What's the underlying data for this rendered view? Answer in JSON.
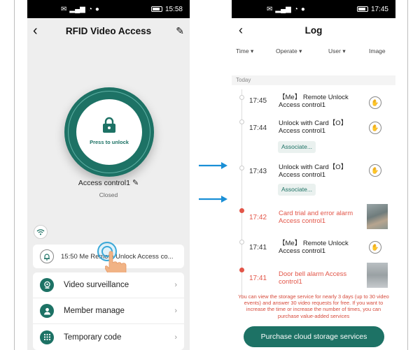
{
  "left_phone": {
    "status": {
      "left": "✉ ᵛᵒₗₗₗ ◔ ■",
      "time": "15:58"
    },
    "header": {
      "title": "RFID Video Access"
    },
    "dial": {
      "label": "Press to unlock"
    },
    "device": {
      "name": "Access control1",
      "status": "Closed"
    },
    "notification": {
      "text": "15:50 Me  Remote Unlock Access co..."
    },
    "menu": [
      {
        "label": "Video surveillance"
      },
      {
        "label": "Member manage"
      },
      {
        "label": "Temporary code"
      }
    ]
  },
  "right_phone": {
    "status": {
      "time": "17:45"
    },
    "header": {
      "title": "Log"
    },
    "filters": {
      "time": "Time",
      "operate": "Operate",
      "user": "User",
      "image": "Image"
    },
    "section": "Today",
    "entries": [
      {
        "time": "17:45",
        "desc": "【Me】 Remote Unlock Access control1",
        "alert": false
      },
      {
        "time": "17:44",
        "desc": "Unlock with Card【O】 Access control1",
        "alert": false,
        "associate": "Associate..."
      },
      {
        "time": "17:43",
        "desc": "Unlock with Card【O】 Access control1",
        "alert": false,
        "associate": "Associate..."
      },
      {
        "time": "17:42",
        "desc": "Card trial and error alarm Access control1",
        "alert": true
      },
      {
        "time": "17:41",
        "desc": "【Me】 Remote Unlock Access control1",
        "alert": false
      },
      {
        "time": "17:41",
        "desc": "Door bell alarm Access control1",
        "alert": true
      }
    ],
    "notice": "You can view the storage service for nearly 3 days (up to 30 video events) and answer 30 video requests for free. If you want to increase the time or increase the number of times, you can purchase value-added services",
    "purchase_button": "Purchase cloud storage services"
  },
  "colors": {
    "accent": "#1d7265",
    "alert": "#e25548",
    "arrow": "#1a8fd6"
  }
}
